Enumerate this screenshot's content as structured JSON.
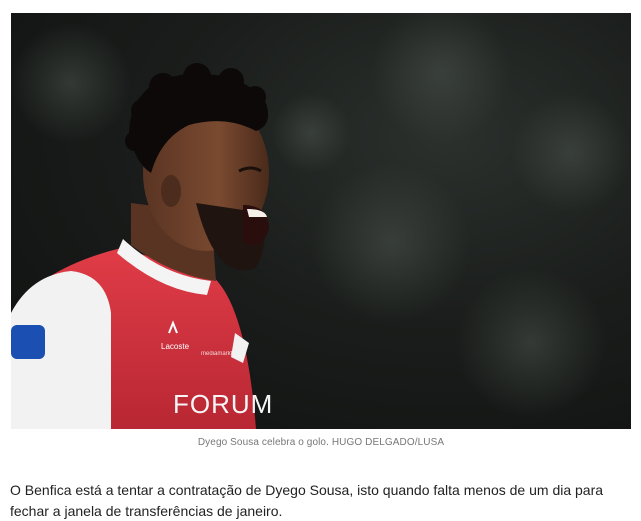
{
  "article": {
    "photo": {
      "subject": "football-player-celebrating",
      "shirt_text": "FORUM",
      "sponsor_text": "Lacoste"
    },
    "caption": "Dyego Sousa celebra o golo. HUGO DELGADO/LUSA",
    "paragraph": "O Benfica está a tentar a contratação de Dyego Sousa, isto quando falta menos de um dia para fechar a janela de transferências de janeiro."
  },
  "colors": {
    "shirt_red": "#d9343f",
    "background_dark": "#1a1d1b",
    "caption_gray": "#777777",
    "text": "#222222"
  }
}
